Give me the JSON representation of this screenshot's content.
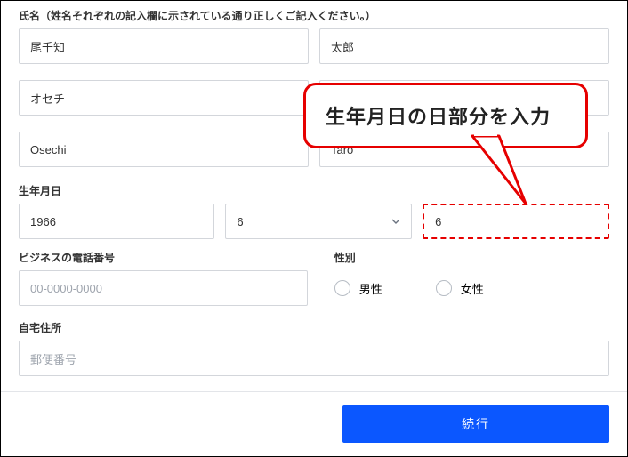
{
  "name_section": {
    "label": "氏名（姓名それぞれの記入欄に示されている通り正しくご記入ください。）",
    "name1_last": "尾千知",
    "name1_first": "太郎",
    "name2_last": "オセチ",
    "name2_first": "",
    "name3_last": "Osechi",
    "name3_first": "Taro"
  },
  "birthday": {
    "label": "生年月日",
    "year": "1966",
    "month": "6",
    "day": "6"
  },
  "phone": {
    "label": "ビジネスの電話番号",
    "placeholder": "00-0000-0000"
  },
  "gender": {
    "label": "性別",
    "male": "男性",
    "female": "女性"
  },
  "address": {
    "label": "自宅住所",
    "postal_placeholder": "郵便番号"
  },
  "submit": "続行",
  "callout": "生年月日の日部分を入力"
}
